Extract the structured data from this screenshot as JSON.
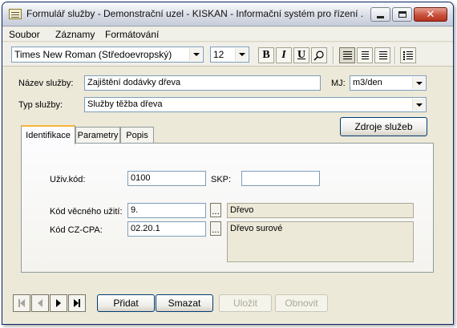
{
  "window": {
    "title": "Formulář služby - Demonstrační uzel - KISKAN - Informační systém pro řízení ..."
  },
  "menu": [
    "Soubor",
    "Záznamy",
    "Formátování"
  ],
  "toolbar": {
    "font_name": "Times New Roman (Středoevropský)",
    "font_size": "12",
    "bold": "B",
    "italic": "I",
    "underline": "U"
  },
  "form": {
    "nazev_label": "Název služby:",
    "nazev_value": "Zajištění dodávky dřeva",
    "mj_label": "MJ:",
    "mj_value": "m3/den",
    "typ_label": "Typ služby:",
    "typ_value": "Služby těžba dřeva",
    "zdroje_button": "Zdroje služeb"
  },
  "tabs": [
    "Identifikace",
    "Parametry",
    "Popis"
  ],
  "identifikace": {
    "uziv_kod_label": "Uživ.kód:",
    "uziv_kod_value": "0100",
    "skp_label": "SKP:",
    "skp_value": "",
    "kod_vecneho_label": "Kód věcného užití:",
    "kod_vecneho_value": "9.",
    "kod_vecneho_desc": "Dřevo",
    "kod_cz_cpa_label": "Kód CZ-CPA:",
    "kod_cz_cpa_value": "02.20.1",
    "kod_cz_cpa_desc": "Dřevo surové",
    "ellipsis": "..."
  },
  "bottom": {
    "pridat": "Přidat",
    "smazat": "Smazat",
    "ulozit": "Uložit",
    "obnovit": "Obnovit"
  },
  "colors": {
    "window_bg": "#ece9d8",
    "field_border": "#7f9db9",
    "tab_highlight": "#f5b43a",
    "disabled_text": "#aca899"
  }
}
